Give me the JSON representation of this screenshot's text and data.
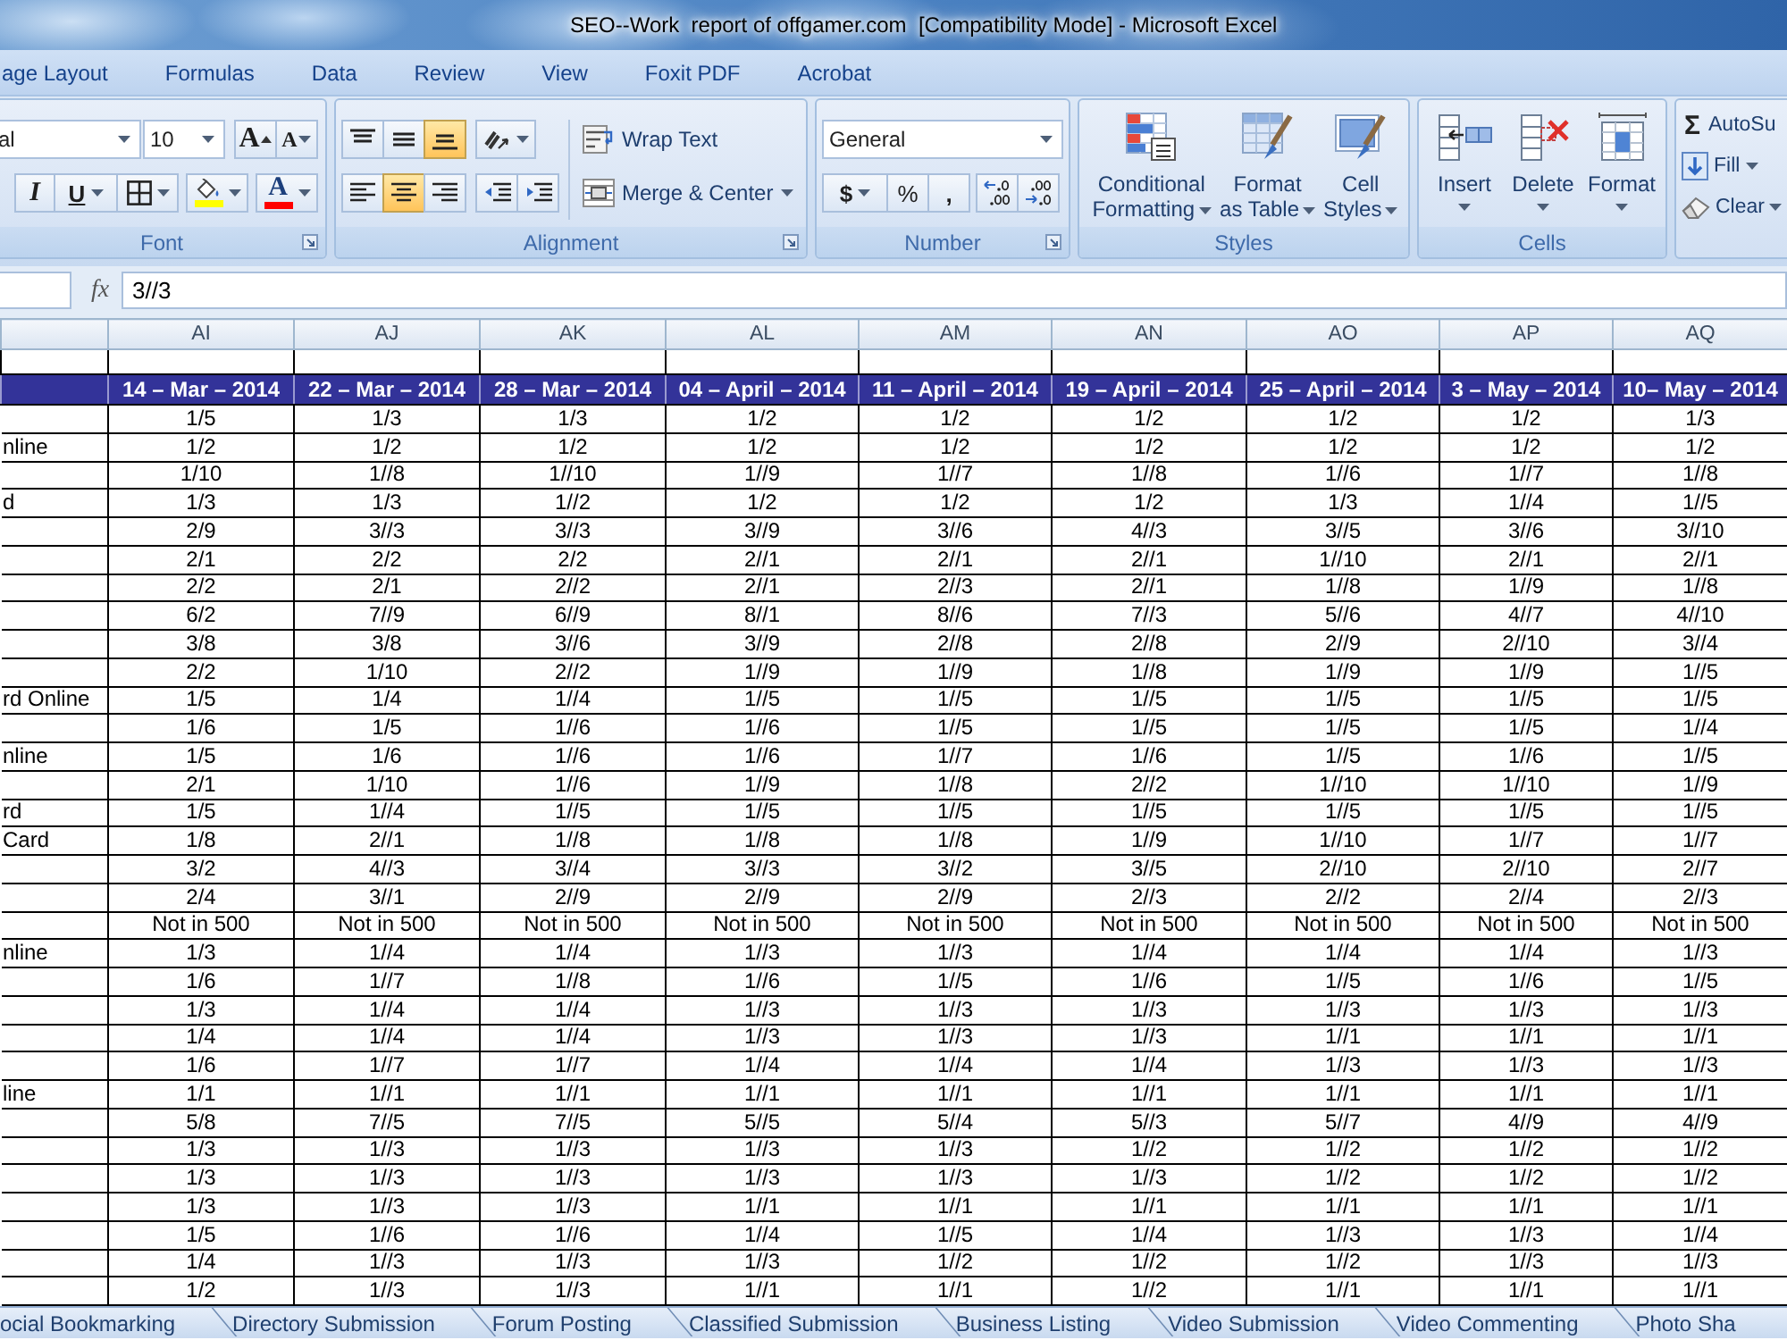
{
  "window": {
    "title": "SEO--Work  report of offgamer.com  [Compatibility Mode] - Microsoft Excel"
  },
  "ribbon_tabs": [
    {
      "label": "age Layout",
      "selected": false
    },
    {
      "label": "Formulas",
      "selected": false
    },
    {
      "label": "Data",
      "selected": false
    },
    {
      "label": "Review",
      "selected": false
    },
    {
      "label": "View",
      "selected": false
    },
    {
      "label": "Foxit PDF",
      "selected": false
    },
    {
      "label": "Acrobat",
      "selected": false
    }
  ],
  "ribbon": {
    "font": {
      "label": "Font",
      "font_name": "al",
      "font_size": "10",
      "grow": "A",
      "shrink": "A",
      "italic": "I",
      "underline": "U",
      "color_buttons": [
        {
          "kind": "fill",
          "color": "#ffff00"
        },
        {
          "kind": "font_color",
          "glyph": "A",
          "color": "#ff0000"
        }
      ]
    },
    "alignment": {
      "label": "Alignment",
      "vertical": [
        {
          "kind": "top",
          "selected": false
        },
        {
          "kind": "middle",
          "selected": false
        },
        {
          "kind": "bottom",
          "selected": true
        }
      ],
      "horizontal": [
        {
          "kind": "left",
          "selected": false
        },
        {
          "kind": "center",
          "selected": true
        },
        {
          "kind": "right",
          "selected": false
        }
      ],
      "wrap_text": "Wrap Text",
      "merge": "Merge & Center"
    },
    "number": {
      "label": "Number",
      "format": "General",
      "currency": "$",
      "percent": "%",
      "comma": ","
    },
    "styles": {
      "label": "Styles",
      "buttons": [
        {
          "kind": "conditional",
          "lines": [
            "Conditional",
            "Formatting"
          ]
        },
        {
          "kind": "table",
          "lines": [
            "Format",
            "as Table"
          ]
        },
        {
          "kind": "cell",
          "lines": [
            "Cell",
            "Styles"
          ]
        }
      ]
    },
    "cells": {
      "label": "Cells",
      "buttons": [
        {
          "kind": "insert",
          "label": "Insert"
        },
        {
          "kind": "delete",
          "label": "Delete"
        },
        {
          "kind": "format",
          "label": "Format"
        }
      ]
    },
    "editing": {
      "buttons": [
        {
          "kind": "autosum",
          "symbol": "Σ",
          "label": "AutoSu"
        },
        {
          "kind": "fill",
          "label": "Fill"
        },
        {
          "kind": "clear",
          "label": "Clear"
        }
      ]
    }
  },
  "formula_bar": {
    "function_button": "fx",
    "value": "3//3"
  },
  "sheet": {
    "column_letters": [
      "AI",
      "AJ",
      "AK",
      "AL",
      "AM",
      "AN",
      "AO",
      "AP",
      "AQ"
    ],
    "header_row": [
      "14 – Mar – 2014",
      "22 – Mar – 2014",
      "28 – Mar – 2014",
      "04 – April – 2014",
      "11 – April – 2014",
      "19 – April – 2014",
      "25 – April – 2014",
      "3 – May – 2014",
      "10– May – 2014"
    ],
    "rows": [
      {
        "cells": [
          "1/5",
          "1/3",
          "1/3",
          "1/2",
          "1/2",
          "1/2",
          "1/2",
          "1/2",
          "1/3"
        ]
      },
      {
        "label": "nline",
        "cells": [
          "1/2",
          "1/2",
          "1/2",
          "1/2",
          "1/2",
          "1/2",
          "1/2",
          "1/2",
          "1/2"
        ]
      },
      {
        "cells": [
          "1/10",
          "1//8",
          "1//10",
          "1//9",
          "1//7",
          "1//8",
          "1//6",
          "1//7",
          "1//8"
        ]
      },
      {
        "label": "d",
        "cells": [
          "1/3",
          "1/3",
          "1//2",
          "1/2",
          "1/2",
          "1/2",
          "1/3",
          "1//4",
          "1//5"
        ]
      },
      {
        "cells": [
          "2/9",
          "3//3",
          "3//3",
          "3//9",
          "3//6",
          "4//3",
          "3//5",
          "3//6",
          "3//10"
        ]
      },
      {
        "cells": [
          "2/1",
          "2/2",
          "2/2",
          "2//1",
          "2//1",
          "2//1",
          "1//10",
          "2//1",
          "2//1"
        ]
      },
      {
        "cells": [
          "2/2",
          "2/1",
          "2//2",
          "2//1",
          "2//3",
          "2//1",
          "1//8",
          "1//9",
          "1//8"
        ]
      },
      {
        "cells": [
          "6/2",
          "7//9",
          "6//9",
          "8//1",
          "8//6",
          "7//3",
          "5//6",
          "4//7",
          "4//10"
        ]
      },
      {
        "cells": [
          "3/8",
          "3/8",
          "3//6",
          "3//9",
          "2//8",
          "2//8",
          "2//9",
          "2//10",
          "3//4"
        ]
      },
      {
        "cells": [
          "2/2",
          "1/10",
          "2//2",
          "1//9",
          "1//9",
          "1//8",
          "1//9",
          "1//9",
          "1//5"
        ]
      },
      {
        "label": "rd Online",
        "cells": [
          "1/5",
          "1/4",
          "1//4",
          "1//5",
          "1//5",
          "1//5",
          "1//5",
          "1//5",
          "1//5"
        ]
      },
      {
        "cells": [
          "1/6",
          "1/5",
          "1//6",
          "1//6",
          "1//5",
          "1//5",
          "1//5",
          "1//5",
          "1//4"
        ]
      },
      {
        "label": "nline",
        "cells": [
          "1/5",
          "1/6",
          "1//6",
          "1//6",
          "1//7",
          "1//6",
          "1//5",
          "1//6",
          "1//5"
        ]
      },
      {
        "cells": [
          "2/1",
          "1/10",
          "1//6",
          "1//9",
          "1//8",
          "2//2",
          "1//10",
          "1//10",
          "1//9"
        ]
      },
      {
        "label": "rd",
        "cells": [
          "1/5",
          "1//4",
          "1//5",
          "1//5",
          "1//5",
          "1//5",
          "1//5",
          "1//5",
          "1//5"
        ]
      },
      {
        "label": "Card",
        "cells": [
          "1/8",
          "2//1",
          "1//8",
          "1//8",
          "1//8",
          "1//9",
          "1//10",
          "1//7",
          "1//7"
        ]
      },
      {
        "cells": [
          "3/2",
          "4//3",
          "3//4",
          "3//3",
          "3//2",
          "3//5",
          "2//10",
          "2//10",
          "2//7"
        ]
      },
      {
        "cells": [
          "2/4",
          "3//1",
          "2//9",
          "2//9",
          "2//9",
          "2//3",
          "2//2",
          "2//4",
          "2//3"
        ]
      },
      {
        "cells": [
          "Not in 500",
          "Not in 500",
          "Not in 500",
          "Not in 500",
          "Not in 500",
          "Not in 500",
          "Not in 500",
          "Not in 500",
          "Not in 500"
        ]
      },
      {
        "label": "nline",
        "cells": [
          "1/3",
          "1//4",
          "1//4",
          "1//3",
          "1//3",
          "1//4",
          "1//4",
          "1//4",
          "1//3"
        ]
      },
      {
        "cells": [
          "1/6",
          "1//7",
          "1//8",
          "1//6",
          "1//5",
          "1//6",
          "1//5",
          "1//6",
          "1//5"
        ]
      },
      {
        "cells": [
          "1/3",
          "1//4",
          "1//4",
          "1//3",
          "1//3",
          "1//3",
          "1//3",
          "1//3",
          "1//3"
        ]
      },
      {
        "cells": [
          "1/4",
          "1//4",
          "1//4",
          "1//3",
          "1//3",
          "1//3",
          "1//1",
          "1//1",
          "1//1"
        ]
      },
      {
        "cells": [
          "1/6",
          "1//7",
          "1//7",
          "1//4",
          "1//4",
          "1//4",
          "1//3",
          "1//3",
          "1//3"
        ]
      },
      {
        "label": "line",
        "cells": [
          "1/1",
          "1//1",
          "1//1",
          "1//1",
          "1//1",
          "1//1",
          "1//1",
          "1//1",
          "1//1"
        ]
      },
      {
        "cells": [
          "5/8",
          "7//5",
          "7//5",
          "5//5",
          "5//4",
          "5//3",
          "5//7",
          "4//9",
          "4//9"
        ]
      },
      {
        "cells": [
          "1/3",
          "1//3",
          "1//3",
          "1//3",
          "1//3",
          "1//2",
          "1//2",
          "1//2",
          "1//2"
        ]
      },
      {
        "cells": [
          "1/3",
          "1//3",
          "1//3",
          "1//3",
          "1//3",
          "1//3",
          "1//2",
          "1//2",
          "1//2"
        ]
      },
      {
        "cells": [
          "1/3",
          "1//3",
          "1//3",
          "1//1",
          "1//1",
          "1//1",
          "1//1",
          "1//1",
          "1//1"
        ]
      },
      {
        "cells": [
          "1/5",
          "1//6",
          "1//6",
          "1//4",
          "1//5",
          "1//4",
          "1//3",
          "1//3",
          "1//4"
        ]
      },
      {
        "cells": [
          "1/4",
          "1//3",
          "1//3",
          "1//3",
          "1//2",
          "1//2",
          "1//2",
          "1//3",
          "1//3"
        ]
      },
      {
        "cells": [
          "1/2",
          "1//3",
          "1//3",
          "1//1",
          "1//1",
          "1//2",
          "1//1",
          "1//1",
          "1//1"
        ]
      }
    ]
  },
  "sheet_tabs": [
    {
      "label": "ocial Bookmarking",
      "selected": false
    },
    {
      "label": "Directory Submission",
      "selected": false
    },
    {
      "label": "Forum Posting",
      "selected": false
    },
    {
      "label": "Classified Submission",
      "selected": false
    },
    {
      "label": "Business Listing",
      "selected": false
    },
    {
      "label": "Video Submission",
      "selected": false
    },
    {
      "label": "Video Commenting",
      "selected": false
    },
    {
      "label": "Photo Sha",
      "selected": false
    }
  ]
}
